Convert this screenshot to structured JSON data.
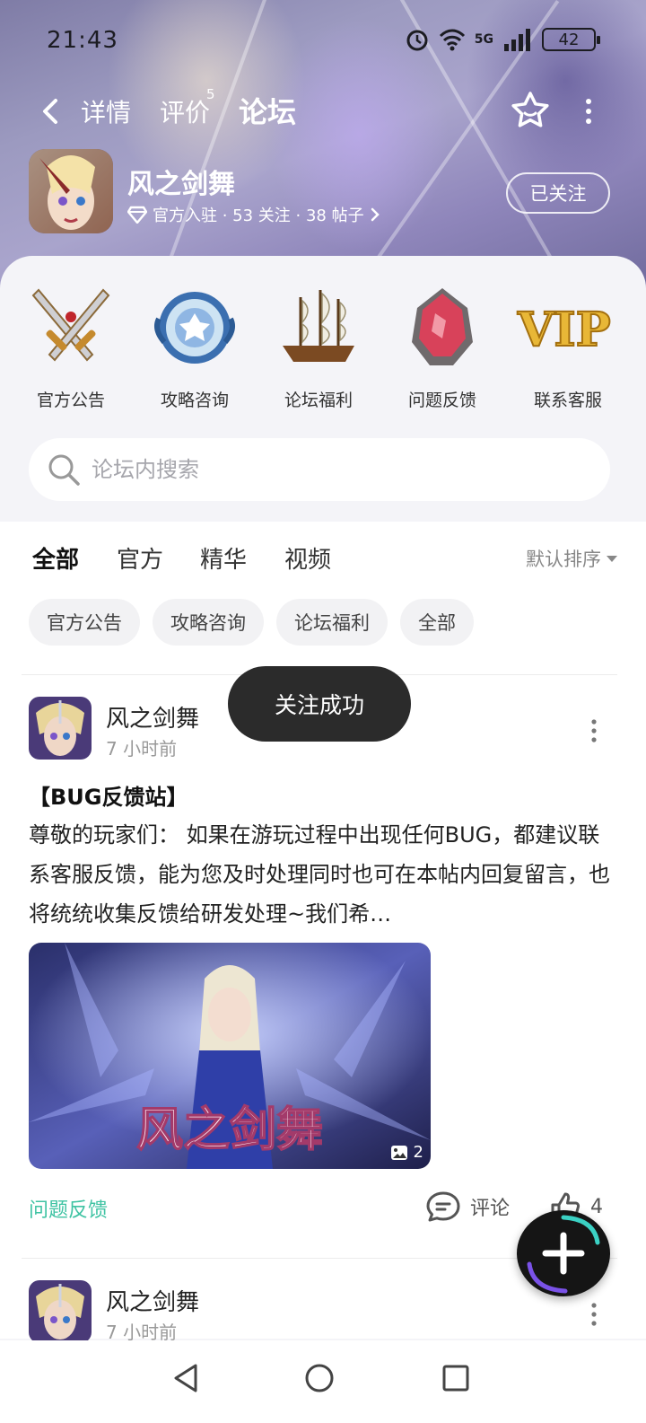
{
  "status_bar": {
    "time": "21:43",
    "battery": "42",
    "network": "5G"
  },
  "nav": {
    "tabs": [
      {
        "label": "详情",
        "active": false
      },
      {
        "label": "评价",
        "badge": "5",
        "active": false
      },
      {
        "label": "论坛",
        "active": true
      }
    ]
  },
  "game": {
    "name": "风之剑舞",
    "meta": "官方入驻 · 53 关注 · 38 帖子",
    "follow_label": "已关注"
  },
  "shortcuts": [
    {
      "label": "官方公告",
      "icon": "crossed-swords-icon"
    },
    {
      "label": "攻略咨询",
      "icon": "blue-emblem-icon"
    },
    {
      "label": "论坛福利",
      "icon": "sailing-ship-icon"
    },
    {
      "label": "问题反馈",
      "icon": "red-crystal-icon"
    },
    {
      "label": "联系客服",
      "icon": "vip-icon"
    }
  ],
  "search": {
    "placeholder": "论坛内搜索"
  },
  "filter_tabs": [
    {
      "label": "全部",
      "active": true
    },
    {
      "label": "官方",
      "active": false
    },
    {
      "label": "精华",
      "active": false
    },
    {
      "label": "视频",
      "active": false
    }
  ],
  "sort_label": "默认排序",
  "chips": [
    "官方公告",
    "攻略咨询",
    "论坛福利",
    "全部"
  ],
  "toast": "关注成功",
  "posts": [
    {
      "author": "风之剑舞",
      "time": "7 小时前",
      "title": "【BUG反馈站】",
      "body": "尊敬的玩家们：  如果在游玩过程中出现任何BUG，都建议联系客服反馈，能为您及时处理同时也可在本帖内回复留言，也将统统收集反馈给研发处理~我们希…",
      "image_count": "2",
      "image_caption": "风之剑舞",
      "tag": "问题反馈",
      "comment_label": "评论",
      "likes": "4"
    },
    {
      "author": "风之剑舞",
      "time": "7 小时前"
    }
  ],
  "colors": {
    "accent": "#46d3b0",
    "tag": "#3fc3a3",
    "toast": "#2b2b2b"
  }
}
